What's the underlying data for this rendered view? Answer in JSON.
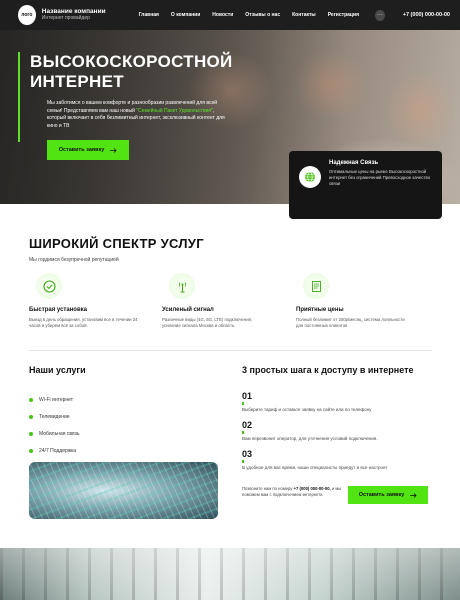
{
  "header": {
    "logo": "лого",
    "brand_name": "Название компании",
    "brand_sub": "Интернет провайдер",
    "nav": [
      "Главная",
      "О компании",
      "Новости",
      "Отзывы о нас",
      "Контакты",
      "Регистрация"
    ],
    "more": "···",
    "phone": "+7 (000) 000-00-00"
  },
  "hero": {
    "title_line1": "ВЫСОКОСКОРОСТНОЙ",
    "title_line2": "ИНТЕРНЕТ",
    "text_before": "Мы заботимся о вашем комфорте и разнообразии развлечений для всей семьи! Представляем вам наш новый",
    "text_highlight": "\"Семейный Пакет Удовольствия\"",
    "text_after": ", который включает в себя безлимитный интернет, эксклюзивный контент для кино и ТВ",
    "button": "Оставить заявку",
    "button_icon": "arrow-right-icon"
  },
  "card": {
    "title": "Надежная Связь",
    "text": "Оптимальные цены на рынке Высокоскоростной интернет без ограничений Превосходное качество связи",
    "icon": "globe-icon"
  },
  "services": {
    "title": "ШИРОКИЙ СПЕКТР УСЛУГ",
    "subtitle": "Мы гордимся безупречной репутацией",
    "features": [
      {
        "icon": "check-circle-icon",
        "title": "Быстрая установка",
        "text": "Выезд в день обращения, установим все в течении 24 часов и уберём всё за собой."
      },
      {
        "icon": "antenna-icon",
        "title": "Усиленый сигнал",
        "text": "Различные виды (4G, 5G, LTE) подключения, усиление сигнала Москва и область."
      },
      {
        "icon": "price-list-icon",
        "title": "Приятные цены",
        "text": "Полный безлимит от 200р/месяц, система лояльности для постоянных клиентов"
      }
    ]
  },
  "our_services": {
    "title": "Наши услуги",
    "items": [
      "Wi-Fi интернет",
      "Телевидение",
      "Мобильная связь",
      "24/7 Поддержка"
    ]
  },
  "steps": {
    "title": "3 простых шага к доступу в интернете",
    "items": [
      {
        "num": "01",
        "text": "Выберите тариф и оставьте заявку на сайте или по телефону"
      },
      {
        "num": "02",
        "text": "Вам перезвонит оператор, для уточнения условий подключения."
      },
      {
        "num": "03",
        "text": "В удобное для вас время, наши специалисты приедут и все настроят"
      }
    ],
    "call_before": "Позвоните нам по номеру",
    "call_phone": "+7 (000) 000-00-00,",
    "call_after": "и мы поможем вам с подключением интернета",
    "button": "Оставить заявку",
    "button_icon": "arrow-right-icon"
  },
  "colors": {
    "accent": "#52e312",
    "dark": "#1e1e1e"
  }
}
